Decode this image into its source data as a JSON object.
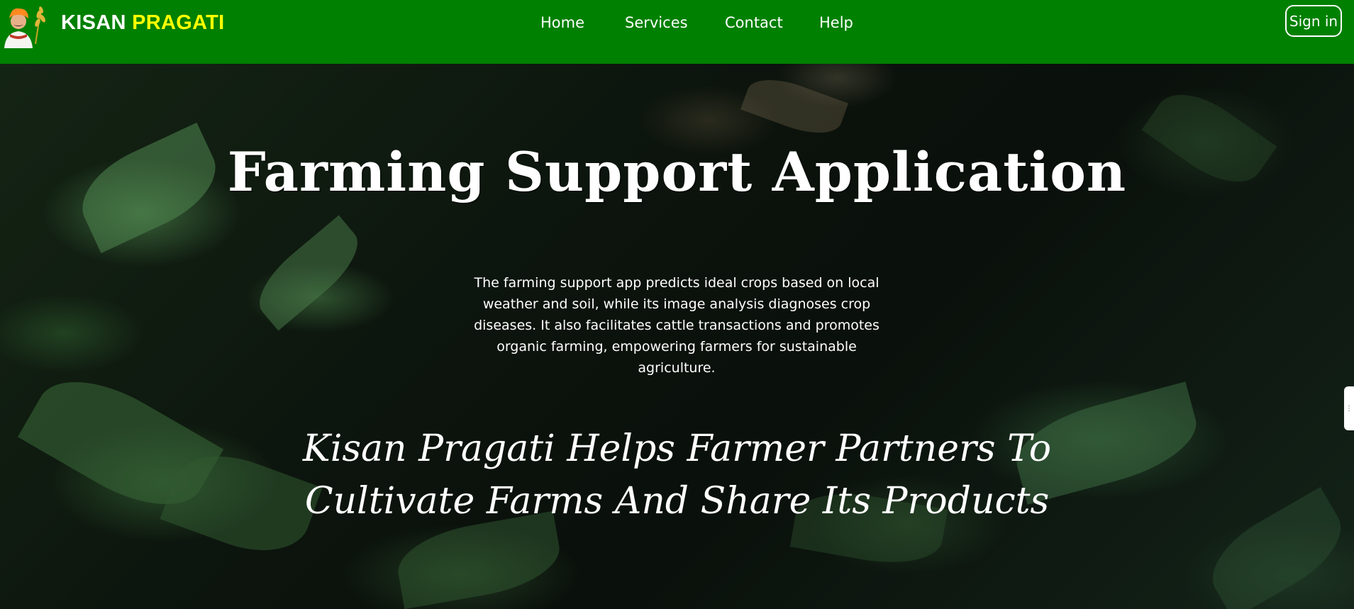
{
  "navbar": {
    "brand_part1": "KISAN",
    "brand_part2": "PRAGATI",
    "links": [
      "Home",
      "Services",
      "Contact",
      "Help"
    ],
    "signin_label": "Sign in"
  },
  "hero": {
    "title": "Farming Support Application",
    "description": "The farming support app predicts ideal crops based on local weather and soil, while its image analysis diagnoses crop diseases. It also facilitates cattle transactions and promotes organic farming, empowering farmers for sustainable agriculture.",
    "tagline_line1": "Kisan Pragati Helps Farmer Partners To",
    "tagline_line2": "Cultivate Farms And Share Its Products"
  },
  "colors": {
    "navbar": "#008000",
    "brand_accent": "#ffff00",
    "text": "#ffffff"
  },
  "icons": {
    "logo": "farmer-avatar-icon",
    "side_tab": "feedback-tab-icon"
  }
}
